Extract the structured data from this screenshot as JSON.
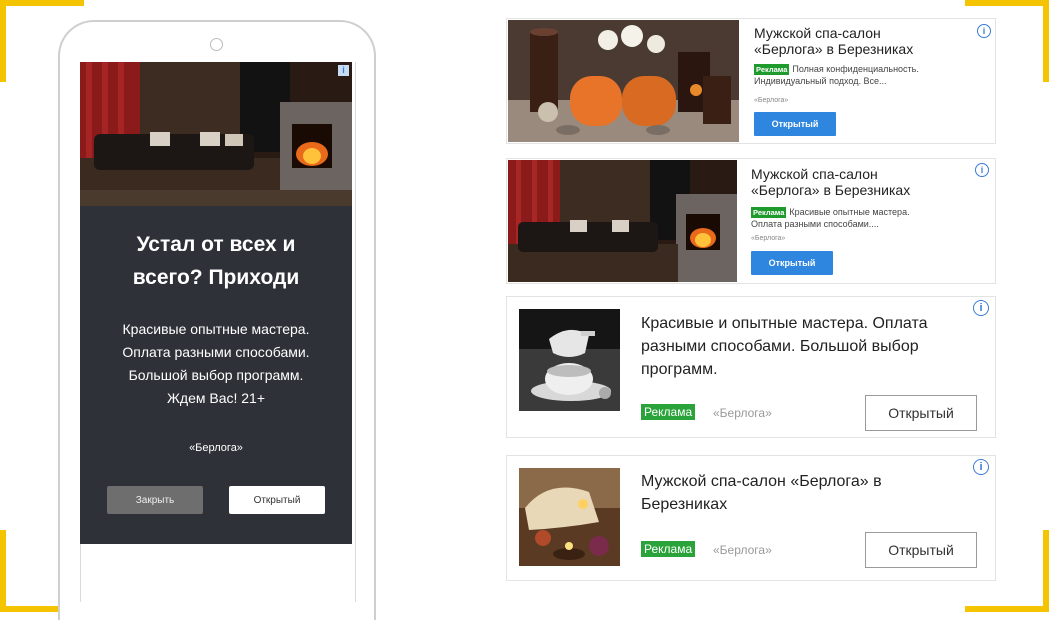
{
  "phone_ad": {
    "title_line1": "Устал от всех и",
    "title_line2": "всего? Приходи",
    "text_lines": [
      "Красивые опытные мастера.",
      "Оплата разными способами.",
      "Большой выбор программ.",
      "Ждем Вас! 21+"
    ],
    "brand": "«Берлога»",
    "close_label": "Закрыть",
    "open_label": "Открытый",
    "info_glyph": "i"
  },
  "cards": [
    {
      "title_line1": "Мужской спа-салон",
      "title_line2": "«Берлога» в Березниках",
      "badge": "Реклама",
      "desc_line1": "Полная конфиденциальность.",
      "desc_line2": "Индивидуальный подход. Все...",
      "brand": "«Берлога»",
      "button": "Открытый"
    },
    {
      "title_line1": "Мужской спа-салон",
      "title_line2": "«Берлога» в Березниках",
      "badge": "Реклама",
      "desc_line1": "Красивые опытные мастера.",
      "desc_line2": "Оплата разными способами....",
      "brand": "«Берлога»",
      "button": "Открытый"
    },
    {
      "text_line1": "Красивые и опытные мастера. Оплата",
      "text_line2": "разными способами. Большой выбор",
      "text_line3": "программ.",
      "badge": "Реклама",
      "brand": "«Берлога»",
      "button": "Открытый"
    },
    {
      "text_line1": "Мужской спа-салон «Берлога» в",
      "text_line2": "Березниках",
      "badge": "Реклама",
      "brand": "«Берлога»",
      "button": "Открытый"
    }
  ],
  "colors": {
    "accent_corner": "#f5c400",
    "ad_badge_green": "#1f9b2e",
    "open_button_blue": "#2e86de",
    "phone_ad_background": "#2e3238"
  },
  "icons": [
    "info-icon",
    "phone-camera-icon"
  ]
}
